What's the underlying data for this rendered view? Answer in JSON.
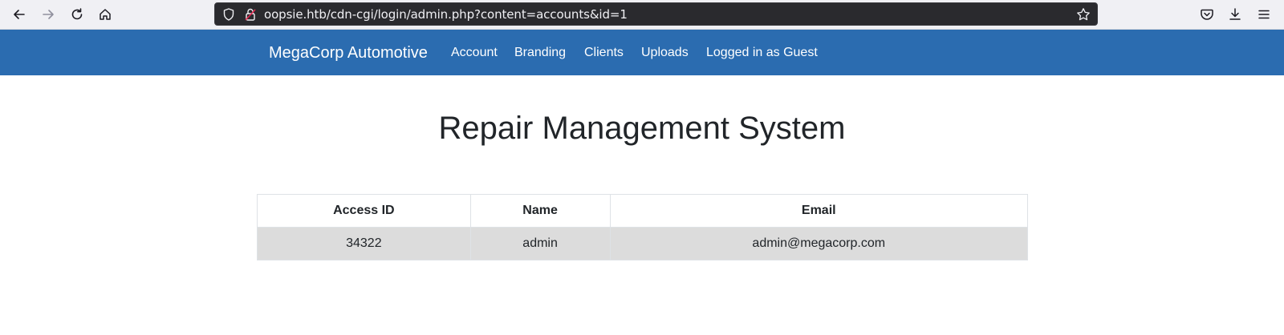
{
  "browser": {
    "url": "oopsie.htb/cdn-cgi/login/admin.php?content=accounts&id=1",
    "icons": [
      "back-arrow-icon",
      "forward-arrow-icon",
      "reload-icon",
      "home-icon",
      "shield-icon",
      "lock-icon",
      "star-icon",
      "pocket-icon",
      "download-icon",
      "menu-icon"
    ]
  },
  "navbar": {
    "brand": "MegaCorp Automotive",
    "links": [
      "Account",
      "Branding",
      "Clients",
      "Uploads",
      "Logged in as Guest"
    ],
    "color": "#2b6cb0"
  },
  "main": {
    "title": "Repair Management System",
    "table": {
      "headers": [
        "Access ID",
        "Name",
        "Email"
      ],
      "rows": [
        [
          "34322",
          "admin",
          "admin@megacorp.com"
        ]
      ]
    }
  }
}
